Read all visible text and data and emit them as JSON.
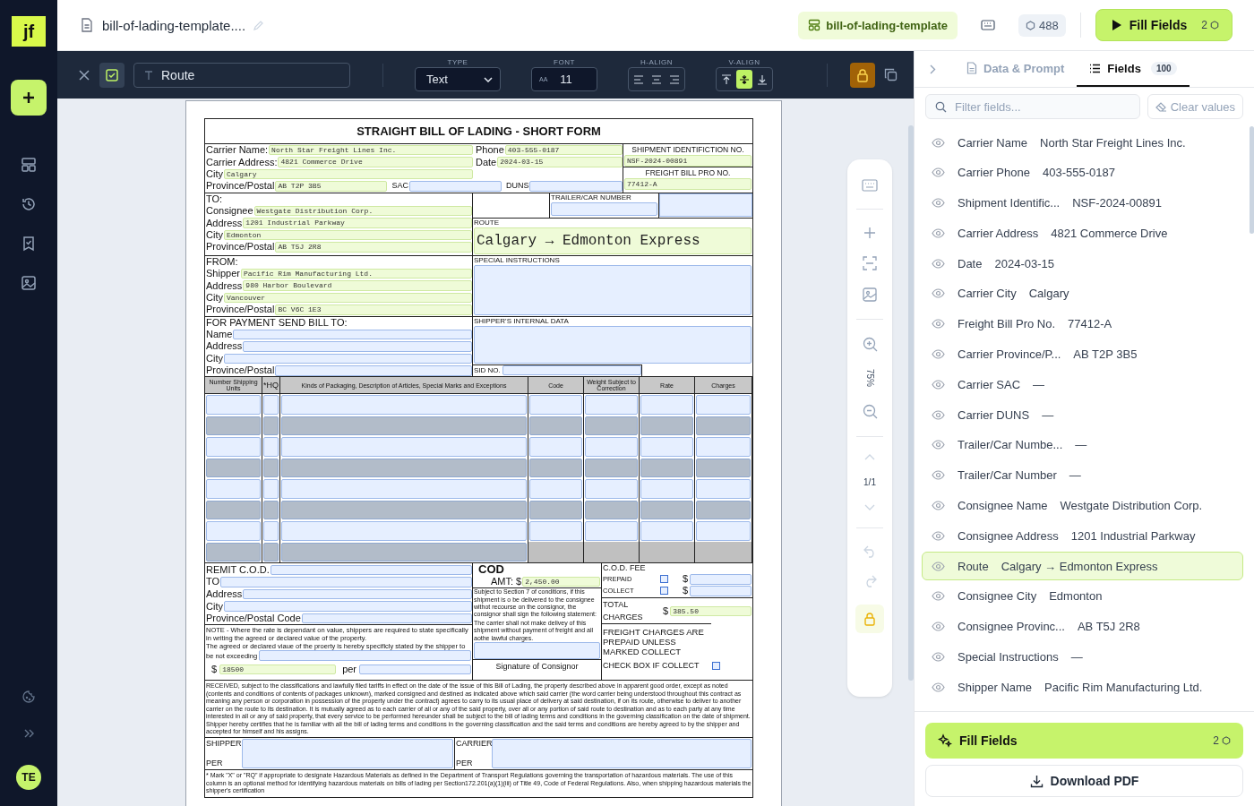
{
  "app": {
    "logo": "jf",
    "avatar": "TE"
  },
  "header": {
    "file_name": "bill-of-lading-template....",
    "template_chip": "bill-of-lading-template",
    "credits": "488",
    "fill_button": "Fill Fields",
    "fill_cost": "2"
  },
  "toolbar": {
    "field_name": "Route",
    "type_label": "TYPE",
    "type_value": "Text",
    "font_label": "FONT",
    "font_glyph": "AA",
    "font_size": "11",
    "halign_label": "H-ALIGN",
    "valign_label": "V-ALIGN",
    "halign": [
      {
        "selected": false
      },
      {
        "selected": false
      },
      {
        "selected": false
      }
    ],
    "valign": [
      {
        "selected": false
      },
      {
        "selected": true
      },
      {
        "selected": false
      }
    ],
    "locked": true
  },
  "side_tools": {
    "zoom": "75%",
    "page": "1/1",
    "lock_on": true
  },
  "document": {
    "title": "STRAIGHT BILL OF LADING - SHORT FORM",
    "carrier": {
      "name": {
        "label": "Carrier Name:",
        "value": "North Star Freight Lines Inc."
      },
      "address": {
        "label": "Carrier Address:",
        "value": "4821 Commerce Drive"
      },
      "city": {
        "label": "City",
        "value": "Calgary"
      },
      "postal": {
        "label": "Province/Postal",
        "value": "AB T2P 3B5"
      },
      "sac": {
        "label": "SAC"
      },
      "duns": {
        "label": "DUNS"
      },
      "phone": {
        "label": "Phone",
        "value": "403-555-0187"
      },
      "date": {
        "label": "Date",
        "value": "2024-03-15"
      }
    },
    "shipment_id": {
      "label": "SHIPMENT IDENTIFICTION NO.",
      "value": "NSF-2024-00891"
    },
    "pro_no": {
      "label": "FREIGHT BILL PRO NO.",
      "value": "77412-A"
    },
    "to": {
      "heading": "TO:",
      "rows": [
        {
          "label": "Consignee",
          "value": "Westgate Distribution Corp."
        },
        {
          "label": "Address",
          "value": "1201 Industrial Parkway"
        },
        {
          "label": "City",
          "value": "Edmonton"
        },
        {
          "label": "Province/Postal",
          "value": "AB T5J 2R8"
        }
      ]
    },
    "trailer": {
      "label": "TRAILER/CAR NUMBER"
    },
    "route": {
      "label": "ROUTE",
      "value": "Calgary → Edmonton Express"
    },
    "from": {
      "heading": "FROM:",
      "rows": [
        {
          "label": "Shipper",
          "value": "Pacific Rim Manufacturing Ltd."
        },
        {
          "label": "Address",
          "value": "980 Harbor Boulevard"
        },
        {
          "label": "City",
          "value": "Vancouver"
        },
        {
          "label": "Province/Postal",
          "value": "BC V6C 1E3"
        }
      ]
    },
    "special": {
      "label": "SPECIAL INSTRUCTIONS"
    },
    "bill_to": {
      "heading": "FOR PAYMENT SEND BILL TO:",
      "rows": [
        {
          "label": "Name"
        },
        {
          "label": "Address"
        },
        {
          "label": "City"
        },
        {
          "label": "Province/Postal"
        }
      ]
    },
    "internal": {
      "label": "SHIPPER'S INTERNAL DATA"
    },
    "sid": {
      "label": "SID NO."
    },
    "items": {
      "columns": [
        "Number Shipping Units",
        "*HQ",
        "Kinds of Packaging, Description of Articles, Special Marks and Exceptions",
        "Code",
        "Weight Subject to Correction",
        "Rate",
        "Charges"
      ],
      "rows": [
        {
          "kind": "plain"
        },
        {
          "kind": "shaded"
        },
        {
          "kind": "plain"
        },
        {
          "kind": "shaded"
        },
        {
          "kind": "plain"
        },
        {
          "kind": "shaded"
        },
        {
          "kind": "plain"
        },
        {
          "kind": "closing"
        }
      ]
    },
    "remit": {
      "rows": [
        {
          "label": "REMIT C.O.D."
        },
        {
          "label": "TO"
        },
        {
          "label": "Address"
        },
        {
          "label": "City"
        },
        {
          "label": "Province/Postal Code"
        }
      ]
    },
    "cod": {
      "title": "COD",
      "amt_label": "AMT: $",
      "amt_value": "2,450.00",
      "terms": "Subject to Section 7 of conditions, if this shipment is o be delivered to the consignee withot recourse on the consignor, the consignor shall sign the following statement:",
      "terms_2": "The carrier shall not make delivey of this shipment without payment of freight and all aothe lawful charges.",
      "signature_label": "Signature of Consignor"
    },
    "cod_fee": {
      "label": "C.O.D. FEE",
      "options": [
        {
          "label": "PREPAID",
          "checked": false,
          "currency": "$"
        },
        {
          "label": "COLLECT",
          "checked": false,
          "currency": "$"
        }
      ]
    },
    "total": {
      "label": "TOTAL CHARGES",
      "currency": "$",
      "value": "385.50"
    },
    "note": {
      "text": "NOTE - Where the rate is dependant on value, shippers are required to state specifically in writing the agreed or declared value of the property.",
      "text_2": "The agreed or declared viaue of the proerty is hereby specificly stated by the shipper to",
      "text_3": "be not exceeding",
      "currency": "$",
      "value": "18500",
      "per": "per"
    },
    "freight": {
      "text": "FREIGHT CHARGES ARE PREPAID UNLESS MARKED COLLECT",
      "check_label": "CHECK BOX IF COLLECT",
      "checked": false
    },
    "received": "RECEIVED, subject to the classifications and lawfully filed tariffs in effect on the date of the issue of this Bill of Lading, the property described above in apparent good order, except as noted (contents and conditions of contents of packages unknown), marked consigned and destined as indicated above which said carrier (the word carrier being understood throughout this contract as meaning any person or corporation in possession of the property under the contract) agrees to carry to its usual place of delivery at said destination, if on its route, otherwise to deliver to another carrier on the route to its destination. It is mutually agreed as to each carrier of all or any of the said property, over all or any portion of said route to destination and as to each party at any time interested in all or any of said property, that every service to be performed hereunder shall be subject to the bill of lading terms and conditions in the governing classification on the date of shipment.  Shipper hereby certifies that he is familiar with all the bill of lading terms and conditions in the governing classification and the said terms and conditions are hereby agreed to by the shipper and accepted for himself and his assigns.",
    "signatures": [
      {
        "label": "SHIPPER",
        "per": "PER"
      },
      {
        "label": "CARRIER",
        "per": "PER"
      }
    ],
    "hazmat": "* Mark \"X\" or \"RQ\" if appropriate to designate Hazardous Materials as defined in the Department of Transport Regulations governing the transportation of hazardous materials.  The use of this column is an optional method for identifying hazardous materials on bills of lading per Section172.201(a)(1)(iii) of Title 49, Code of Federal Regulations.  Also, when shipping hazardous materials the shipper's certification"
  },
  "panel": {
    "tabs": [
      {
        "label": "Data & Prompt",
        "selected": false
      },
      {
        "label": "Fields",
        "selected": true,
        "count": "100"
      }
    ],
    "filter_placeholder": "Filter fields...",
    "clear_button": "Clear values",
    "fields": [
      {
        "name": "Carrier Name",
        "value": "North Star Freight Lines Inc.",
        "selected": false
      },
      {
        "name": "Carrier Phone",
        "value": "403-555-0187",
        "selected": false
      },
      {
        "name": "Shipment Identific...",
        "value": "NSF-2024-00891",
        "selected": false
      },
      {
        "name": "Carrier Address",
        "value": "4821 Commerce Drive",
        "selected": false
      },
      {
        "name": "Date",
        "value": "2024-03-15",
        "selected": false
      },
      {
        "name": "Carrier City",
        "value": "Calgary",
        "selected": false
      },
      {
        "name": "Freight Bill Pro No.",
        "value": "77412-A",
        "selected": false
      },
      {
        "name": "Carrier Province/P...",
        "value": "AB T2P 3B5",
        "selected": false
      },
      {
        "name": "Carrier SAC",
        "value": "—",
        "selected": false
      },
      {
        "name": "Carrier DUNS",
        "value": "—",
        "selected": false
      },
      {
        "name": "Trailer/Car Numbe...",
        "value": "—",
        "selected": false
      },
      {
        "name": "Trailer/Car Number",
        "value": "—",
        "selected": false
      },
      {
        "name": "Consignee Name",
        "value": "Westgate Distribution Corp.",
        "selected": false
      },
      {
        "name": "Consignee Address",
        "value": "1201 Industrial Parkway",
        "selected": false
      },
      {
        "name": "Route",
        "value": "Calgary → Edmonton Express",
        "selected": true
      },
      {
        "name": "Consignee City",
        "value": "Edmonton",
        "selected": false
      },
      {
        "name": "Consignee Provinc...",
        "value": "AB T5J 2R8",
        "selected": false
      },
      {
        "name": "Special Instructions",
        "value": "—",
        "selected": false
      },
      {
        "name": "Shipper Name",
        "value": "Pacific Rim Manufacturing Ltd.",
        "selected": false
      }
    ],
    "fill_button": "Fill Fields",
    "fill_cost": "2",
    "download_button": "Download PDF"
  }
}
